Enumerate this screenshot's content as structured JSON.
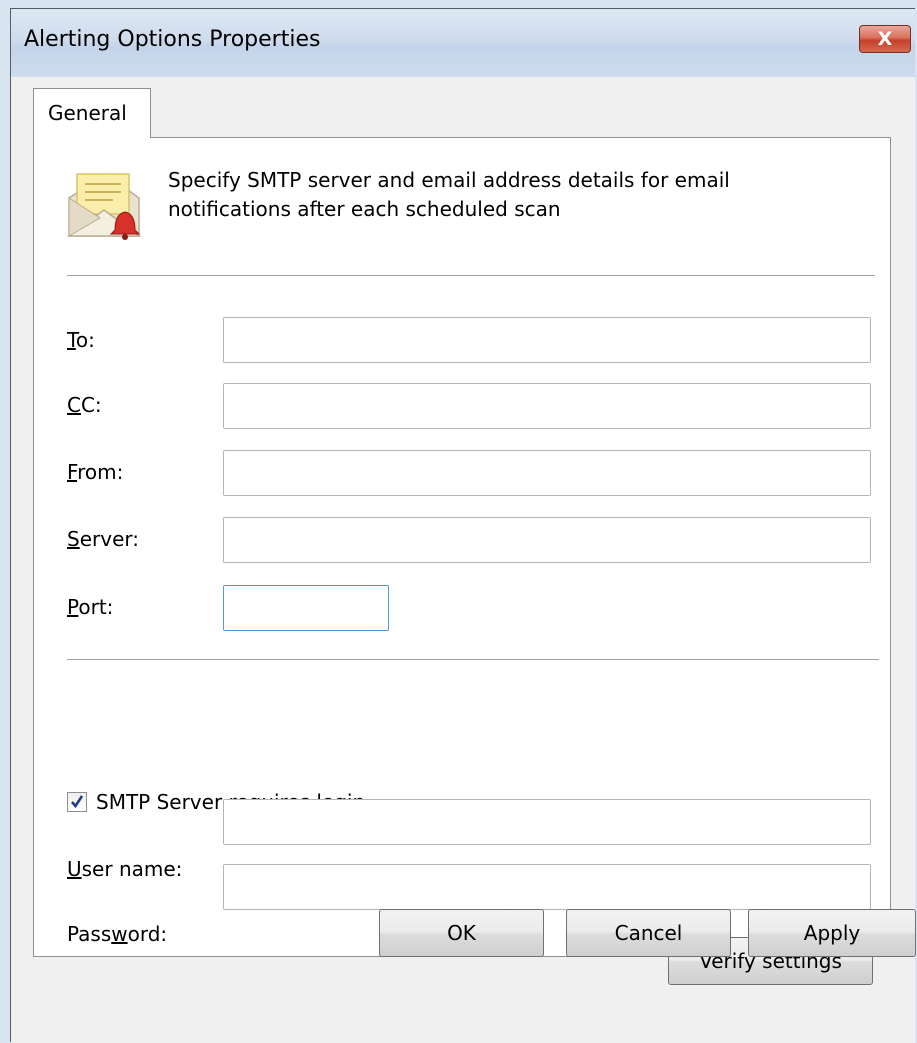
{
  "window": {
    "title": "Alerting Options Properties",
    "close_symbol": "X"
  },
  "tabs": [
    {
      "label": "General",
      "selected": true
    }
  ],
  "header": {
    "icon": "email-alert-icon",
    "description": "Specify SMTP server and email address details for email notifications after each scheduled scan"
  },
  "fields": {
    "to": {
      "label_mn": "T",
      "label_rest": "o:",
      "value": ""
    },
    "cc": {
      "label_mn": "C",
      "label_rest": "C:",
      "value": ""
    },
    "from": {
      "label_mn": "F",
      "label_rest": "rom:",
      "value": ""
    },
    "server": {
      "label_mn": "S",
      "label_rest": "erver:",
      "value": ""
    },
    "port": {
      "label_mn": "P",
      "label_rest": "ort:",
      "value": ""
    }
  },
  "login": {
    "checkbox_label": "SMTP Server requires login",
    "checked": true,
    "username": {
      "label_mn": "U",
      "label_rest": "ser name:",
      "value": ""
    },
    "password": {
      "label_pre": "Pass",
      "label_mn": "w",
      "label_rest": "ord:",
      "value": ""
    }
  },
  "buttons": {
    "verify": "Verify settings",
    "ok": "OK",
    "cancel": "Cancel",
    "apply": "Apply"
  },
  "colors": {
    "close_button": "#c5412b",
    "focus_border": "#4f97d5",
    "checkmark": "#1f3d8a"
  }
}
